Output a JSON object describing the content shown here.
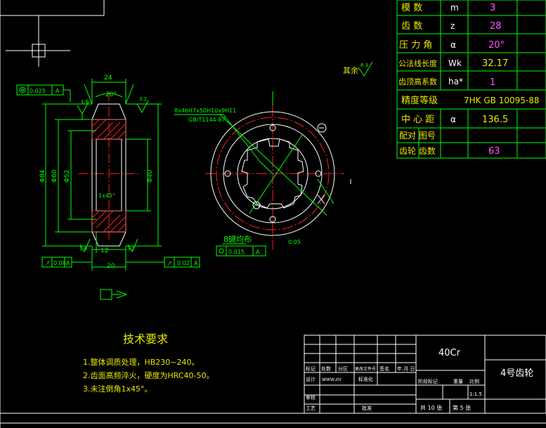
{
  "gear_table": [
    {
      "label": "模  数",
      "symbol": "m",
      "value": "3"
    },
    {
      "label": "齿  数",
      "symbol": "z",
      "value": "28"
    },
    {
      "label": "压 力 角",
      "symbol": "α",
      "value": "20°"
    },
    {
      "label": "公法线长度",
      "symbol": "Wk",
      "value": "32.17"
    },
    {
      "label": "齿顶高系数",
      "symbol": "ha*",
      "value": "1"
    },
    {
      "label": "精度等级",
      "symbol": "",
      "value": "7HK GB 10095-88"
    },
    {
      "label": "中 心 距",
      "symbol": "α",
      "value": "136.5"
    },
    {
      "label": "配对 图号",
      "symbol": "",
      "value": ""
    },
    {
      "label": "齿轮 齿数",
      "symbol": "",
      "value": "63"
    }
  ],
  "section_view": {
    "dim_top": "24",
    "angle": "20°",
    "rough_top": "3.2",
    "rough_left": "1.6",
    "tol_runout": "0.025",
    "tol_runout_ref": "A",
    "dim_outer": "Φ84",
    "dim_mid1": "Φ60",
    "dim_mid2": "Φ52",
    "dim_bore": "Φ40",
    "chamfer": "1x45°",
    "dim_bottom_12": "12",
    "dim_bottom_20": "20",
    "tol_left": "0.08",
    "tol_left_ref": "A",
    "tol_right": "0.02",
    "tol_right_ref": "A",
    "rough_bottom_left": "1.6",
    "rough_bottom_right": "3.2"
  },
  "circle_view": {
    "spline_label1": "8x46H7x50H10x9H11",
    "spline_label2": "GB/T1144-87",
    "holes_label": "8键均布",
    "tol_pos": "0.015",
    "tol_pos_ref": "A",
    "tol_dim": "0.05",
    "rough_all_label": "其余",
    "rough_all": "6.3"
  },
  "tech_req": {
    "title": "技术要求",
    "items": [
      "1.整体调质处理，HB230~240。",
      "2.齿面高频淬火，硬度为HRC40-50。",
      "3.未注倒角1x45°。"
    ]
  },
  "title_block": {
    "material": "40Cr",
    "part_name": "4号齿轮",
    "scale": "1:1.5",
    "header_labels": [
      "标记",
      "处数",
      "分区",
      "更改文件号",
      "签名",
      "年.月.日"
    ],
    "row2_labels": [
      "设计",
      "标准化"
    ],
    "designer": "WWW.zhl",
    "stage_labels": [
      "阶段标记",
      "重量",
      "比例"
    ],
    "row3_labels": [
      "审核"
    ],
    "row4_labels": [
      "工艺",
      "批准"
    ],
    "sheets_total_label": "共 10 张",
    "sheet_no_label": "第 5 张"
  }
}
